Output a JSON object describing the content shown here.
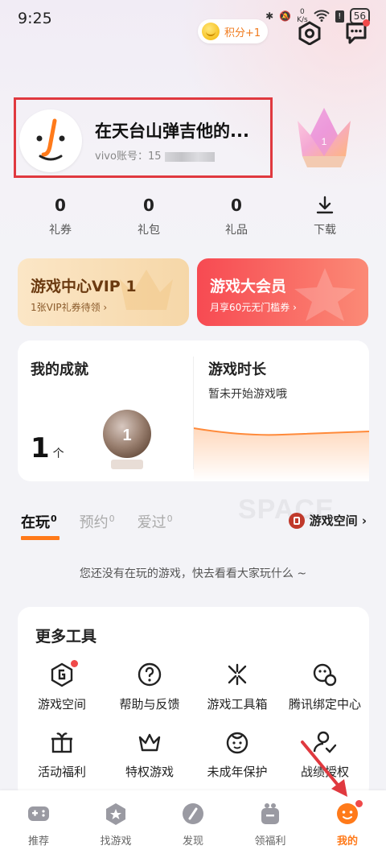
{
  "status": {
    "time": "9:25",
    "net_speed_value": "0",
    "net_speed_unit": "K/s",
    "battery": "56"
  },
  "header": {
    "points_label": "积分+1"
  },
  "profile": {
    "name": "在天台山弹吉他的...",
    "account_label": "vivo账号：",
    "account_value": "15"
  },
  "stats": [
    {
      "value": "0",
      "label": "礼券"
    },
    {
      "value": "0",
      "label": "礼包"
    },
    {
      "value": "0",
      "label": "礼品"
    },
    {
      "label": "下载"
    }
  ],
  "cards": {
    "vip_title": "游戏中心VIP 1",
    "vip_sub": "1张VIP礼券待领 ›",
    "member_title": "游戏大会员",
    "member_sub": "月享60元无门槛券 ›"
  },
  "achievement": {
    "title": "我的成就",
    "count": "1",
    "unit": "个",
    "medal_number": "1"
  },
  "playtime": {
    "title": "游戏时长",
    "subtitle": "暂未开始游戏哦"
  },
  "tabs": [
    {
      "label": "在玩",
      "count": "0"
    },
    {
      "label": "预约",
      "count": "0"
    },
    {
      "label": "爱过",
      "count": "0"
    }
  ],
  "game_space_link": "游戏空间 ›",
  "watermark": "SPACE",
  "empty_text": "您还没有在玩的游戏，快去看看大家玩什么 ~",
  "tools": {
    "title": "更多工具",
    "items": [
      "游戏空间",
      "帮助与反馈",
      "游戏工具箱",
      "腾讯绑定中心",
      "活动福利",
      "特权游戏",
      "未成年保护",
      "战绩授权"
    ]
  },
  "nav": [
    "推荐",
    "找游戏",
    "发现",
    "领福利",
    "我的"
  ],
  "colors": {
    "accent": "#ff7a1a",
    "highlight_box": "#e0393f",
    "member_red": "#f74a52",
    "badge": "#f04a4a"
  }
}
